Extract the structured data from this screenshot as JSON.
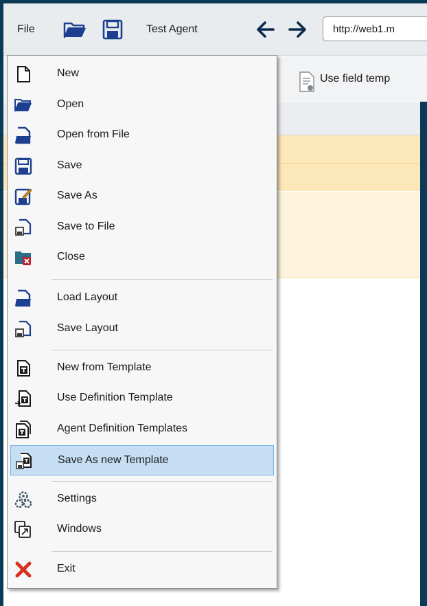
{
  "toolbar": {
    "file_label": "File",
    "agent_label": "Test Agent",
    "url": "http://web1.m",
    "field_template_label": "Use field temp"
  },
  "menu": {
    "items": [
      {
        "label": "New",
        "icon": "new-doc-icon"
      },
      {
        "label": "Open",
        "icon": "folder-open-icon"
      },
      {
        "label": "Open from File",
        "icon": "open-file-icon"
      },
      {
        "label": "Save",
        "icon": "floppy-icon"
      },
      {
        "label": "Save As",
        "icon": "save-as-icon"
      },
      {
        "label": "Save to File",
        "icon": "save-file-icon"
      },
      {
        "label": "Close",
        "icon": "close-folder-icon"
      },
      {
        "label": "Load Layout",
        "icon": "load-layout-icon"
      },
      {
        "label": "Save Layout",
        "icon": "save-layout-icon"
      },
      {
        "label": "New from Template",
        "icon": "template-icon"
      },
      {
        "label": "Use Definition Template",
        "icon": "use-template-icon"
      },
      {
        "label": "Agent Definition Templates",
        "icon": "templates-icon"
      },
      {
        "label": "Save As new Template",
        "icon": "save-template-icon"
      },
      {
        "label": "Settings",
        "icon": "settings-icon"
      },
      {
        "label": "Windows",
        "icon": "windows-icon"
      },
      {
        "label": "Exit",
        "icon": "exit-icon"
      }
    ]
  },
  "colors": {
    "frame": "#0b3a56",
    "menu_bg": "#f7f7f7",
    "selected_bg": "#c5def4",
    "icon_blue": "#1d3f8f",
    "exit_red": "#d6321f"
  }
}
